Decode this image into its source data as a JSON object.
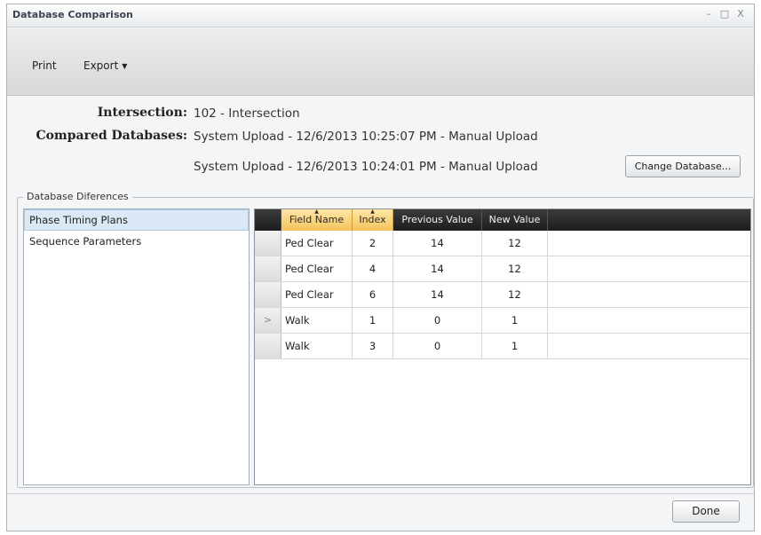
{
  "window": {
    "title": "Database Comparison",
    "controls": {
      "minimize": "–",
      "maximize": "□",
      "close": "X"
    }
  },
  "toolbar": {
    "print_label": "Print",
    "export_label": "Export",
    "export_caret": "▼"
  },
  "info": {
    "intersection_label": "Intersection:",
    "intersection_value": "102 - Intersection",
    "compared_label": "Compared Databases:",
    "database_1": "System Upload - 12/6/2013 10:25:07 PM - Manual Upload",
    "database_2": "System Upload - 12/6/2013 10:24:01 PM - Manual Upload",
    "change_button": "Change Database..."
  },
  "differences": {
    "legend": "Database Diferences",
    "categories": [
      {
        "label": "Phase Timing Plans",
        "selected": true
      },
      {
        "label": "Sequence Parameters",
        "selected": false
      }
    ],
    "columns": [
      "Field Name",
      "Index",
      "Previous Value",
      "New Value"
    ],
    "sorted_columns": [
      "Field Name",
      "Index"
    ],
    "rows": [
      {
        "selector": "",
        "field_name": "Ped Clear",
        "index": "2",
        "previous_value": "14",
        "new_value": "12"
      },
      {
        "selector": "",
        "field_name": "Ped Clear",
        "index": "4",
        "previous_value": "14",
        "new_value": "12"
      },
      {
        "selector": "",
        "field_name": "Ped Clear",
        "index": "6",
        "previous_value": "14",
        "new_value": "12"
      },
      {
        "selector": ">",
        "field_name": "Walk",
        "index": "1",
        "previous_value": "0",
        "new_value": "1"
      },
      {
        "selector": "",
        "field_name": "Walk",
        "index": "3",
        "previous_value": "0",
        "new_value": "1"
      }
    ]
  },
  "footer": {
    "done_label": "Done"
  },
  "colors": {
    "selected_list_item": "#dbe9f6",
    "sorted_header": "#f5c35a",
    "grid_header": "#2b2b2b"
  }
}
